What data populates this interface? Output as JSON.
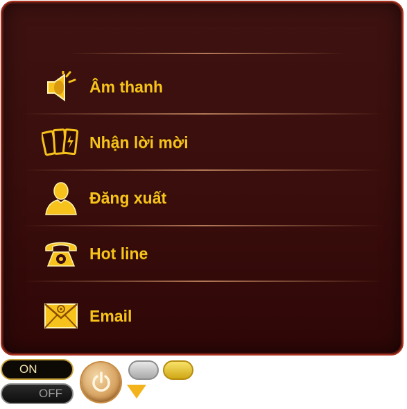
{
  "menu": {
    "items": [
      {
        "label": "Âm thanh",
        "icon": "speaker-icon"
      },
      {
        "label": "Nhận lời mời",
        "icon": "cards-icon"
      },
      {
        "label": "Đăng xuất",
        "icon": "user-icon"
      },
      {
        "label": "Hot line",
        "icon": "telephone-icon"
      },
      {
        "label": "Email",
        "icon": "envelope-icon"
      }
    ]
  },
  "controls": {
    "on_label": "ON",
    "off_label": "OFF"
  },
  "colors": {
    "accent": "#f7c21b",
    "panel_border": "#a8311f",
    "panel_bg": "#3a0e0c"
  }
}
